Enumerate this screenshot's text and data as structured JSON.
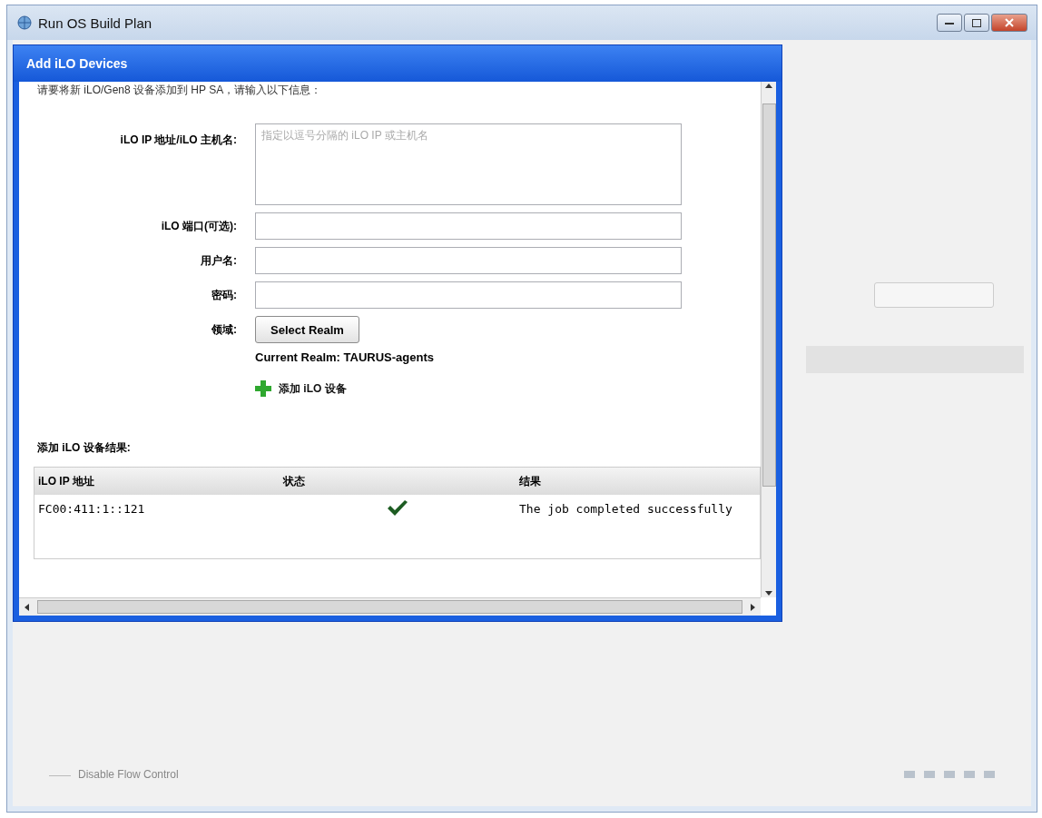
{
  "window": {
    "title": "Run OS Build Plan"
  },
  "background": {
    "checkbox": {
      "label": "Disable Flow Control",
      "checked": false
    }
  },
  "dialog": {
    "title": "Add iLO Devices",
    "intro": "请要将新 iLO/Gen8 设备添加到 HP SA，请输入以下信息：",
    "fields": [
      {
        "kind": "textarea",
        "label": "iLO IP 地址/iLO 主机名:",
        "placeholder": "指定以逗号分隔的 iLO IP 或主机名"
      },
      {
        "kind": "input",
        "label": "iLO 端口(可选):"
      },
      {
        "kind": "input",
        "label": "用户名:"
      },
      {
        "kind": "password",
        "label": "密码:"
      }
    ],
    "realm": {
      "label": "领域:",
      "button": "Select Realm",
      "current": "Current Realm: TAURUS-agents"
    },
    "add_link": "添加 iLO 设备",
    "results": {
      "title": "添加 iLO 设备结果:",
      "columns": [
        "iLO IP 地址",
        "状态",
        "结果"
      ],
      "rows": [
        {
          "ip": "FC00:411:1::121",
          "succeeded": true,
          "result": "The job completed successfully"
        }
      ]
    }
  }
}
